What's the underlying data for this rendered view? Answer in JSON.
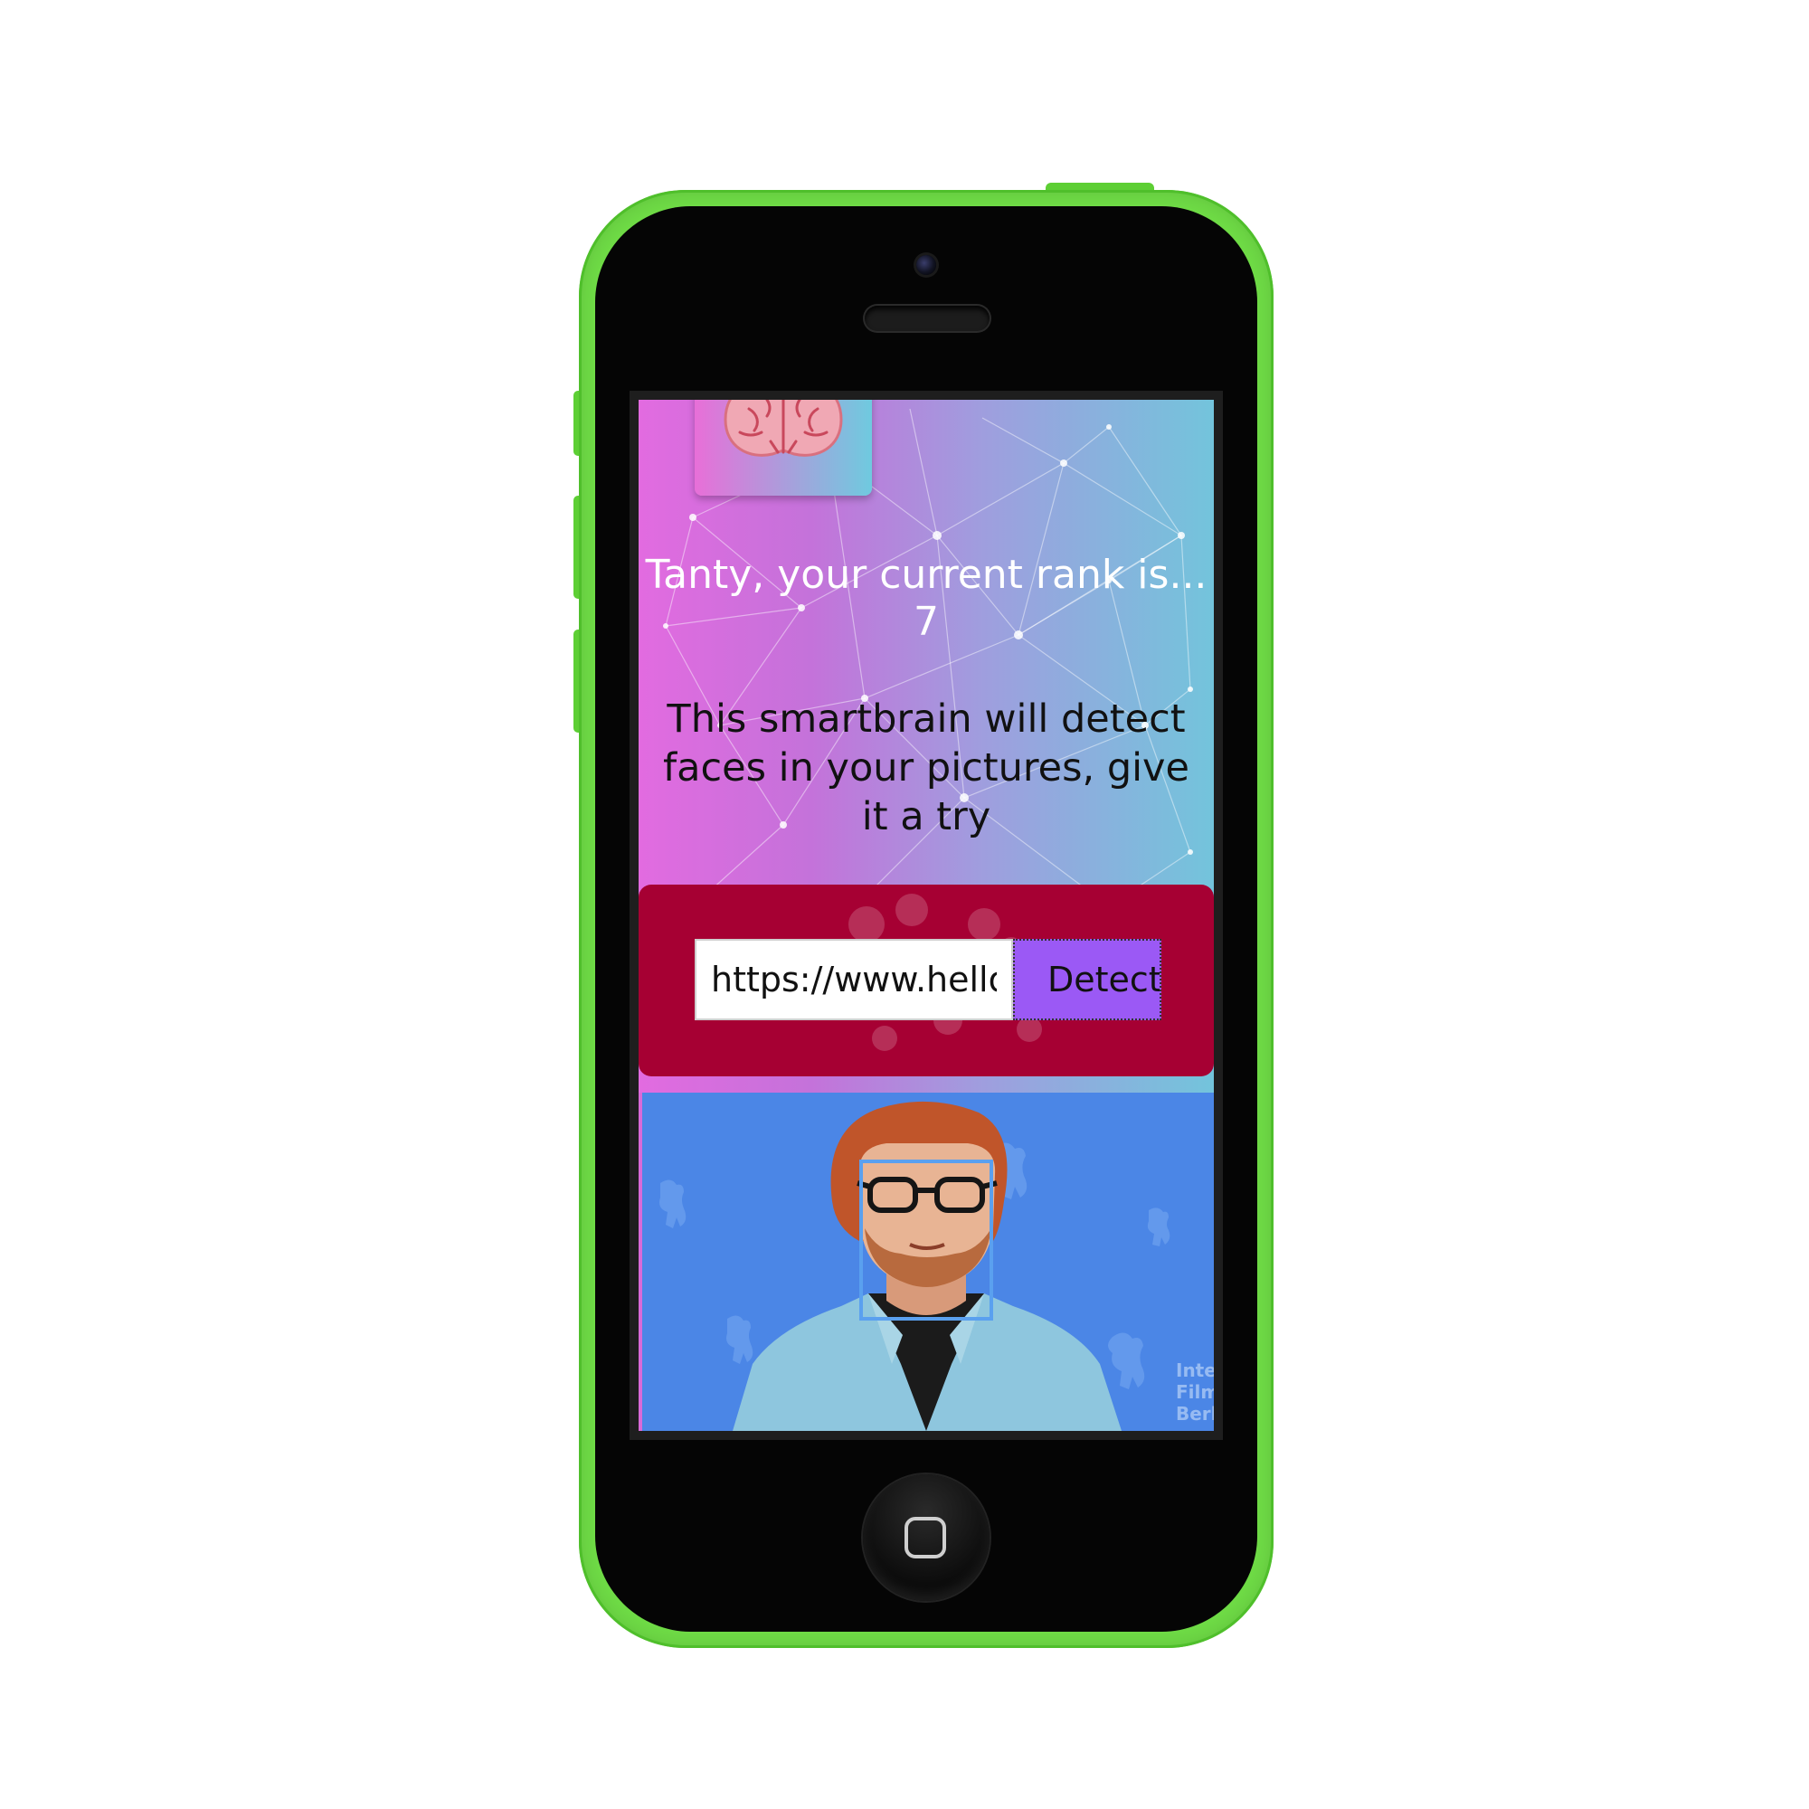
{
  "device": {
    "color": "#6fdc46",
    "camera_icon": "camera-icon",
    "speaker_icon": "speaker-grille",
    "home_icon": "home-button"
  },
  "app": {
    "logo_icon": "brain-icon",
    "rank_text": "Tanty, your current rank is...",
    "rank_value": "7",
    "intro_text": "This smartbrain will detect faces in your pictures, give it a try",
    "form": {
      "url_value": "https://www.hello",
      "detect_label": "Detect"
    },
    "result": {
      "image_label": "detected-face-photo",
      "face_boxes": 1,
      "background_text": "Inte Film Berl"
    },
    "colors": {
      "gradient_left": "#e26be0",
      "gradient_right": "#73c4dc",
      "form_background": "#a60033",
      "detect_button": "#9b59f5",
      "face_box": "#5aa0ef"
    }
  }
}
